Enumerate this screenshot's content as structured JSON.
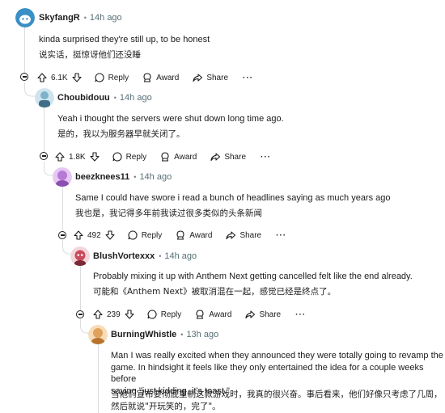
{
  "comments": [
    {
      "author": "SkyfangR",
      "time": "14h ago",
      "text_en": "kinda surprised they're still up, to be honest",
      "text_zh": "说实话，挺惊讶他们还没睡",
      "votes": "6.1K",
      "reply_label": "Reply",
      "award_label": "Award",
      "share_label": "Share",
      "more_label": "···",
      "avatar_icon": "snoo-avatar-icon",
      "avatar_color": "#3a8fc6"
    },
    {
      "author": "Choubidouu",
      "time": "14h ago",
      "text_en": "Yeah i thought the servers were shut down long time ago.",
      "text_zh": "是的，我以为服务器早就关闭了。",
      "votes": "1.8K",
      "reply_label": "Reply",
      "award_label": "Award",
      "share_label": "Share",
      "more_label": "···",
      "avatar_icon": "snoo-avatar-icon",
      "avatar_color": "#7fb3c9"
    },
    {
      "author": "beezknees11",
      "time": "14h ago",
      "text_en": "Same I could have swore i read a bunch of headlines saying as much years ago",
      "text_zh": "我也是，我记得多年前我读过很多类似的头条新闻",
      "votes": "492",
      "reply_label": "Reply",
      "award_label": "Award",
      "share_label": "Share",
      "more_label": "···",
      "avatar_icon": "snoo-avatar-icon",
      "avatar_color": "#b57ad6"
    },
    {
      "author": "BlushVortexxx",
      "time": "14h ago",
      "text_en": "Probably mixing it up with Anthem Next getting cancelled felt like the end already.",
      "text_zh": "可能和《Anthem Next》被取消混在一起，感觉已经是终点了。",
      "votes": "239",
      "reply_label": "Reply",
      "award_label": "Award",
      "share_label": "Share",
      "more_label": "···",
      "avatar_icon": "snoo-avatar-icon",
      "avatar_color": "#c94a5a"
    },
    {
      "author": "BurningWhistle",
      "time": "13h ago",
      "text_en_1": "Man I was really excited when they announced they were totally going to revamp the",
      "text_en_2": "game. In hindsight it feels like they only entertained the idea for a couple weeks before",
      "text_en_3": "saying \"just kidding, it's toast.\"",
      "text_zh_1": "当他们宣布要彻底重制这款游戏时，我真的很兴奋。事后看来，他们好像只考虑了几周，",
      "text_zh_2": "然后就说\"开玩笑的，完了\"。",
      "avatar_icon": "snoo-avatar-icon",
      "avatar_color": "#e0a25a"
    }
  ],
  "separator": "•",
  "colors": {
    "text": "#1c1c1c",
    "meta": "#576f76",
    "thread_line": "#d9dde0"
  }
}
